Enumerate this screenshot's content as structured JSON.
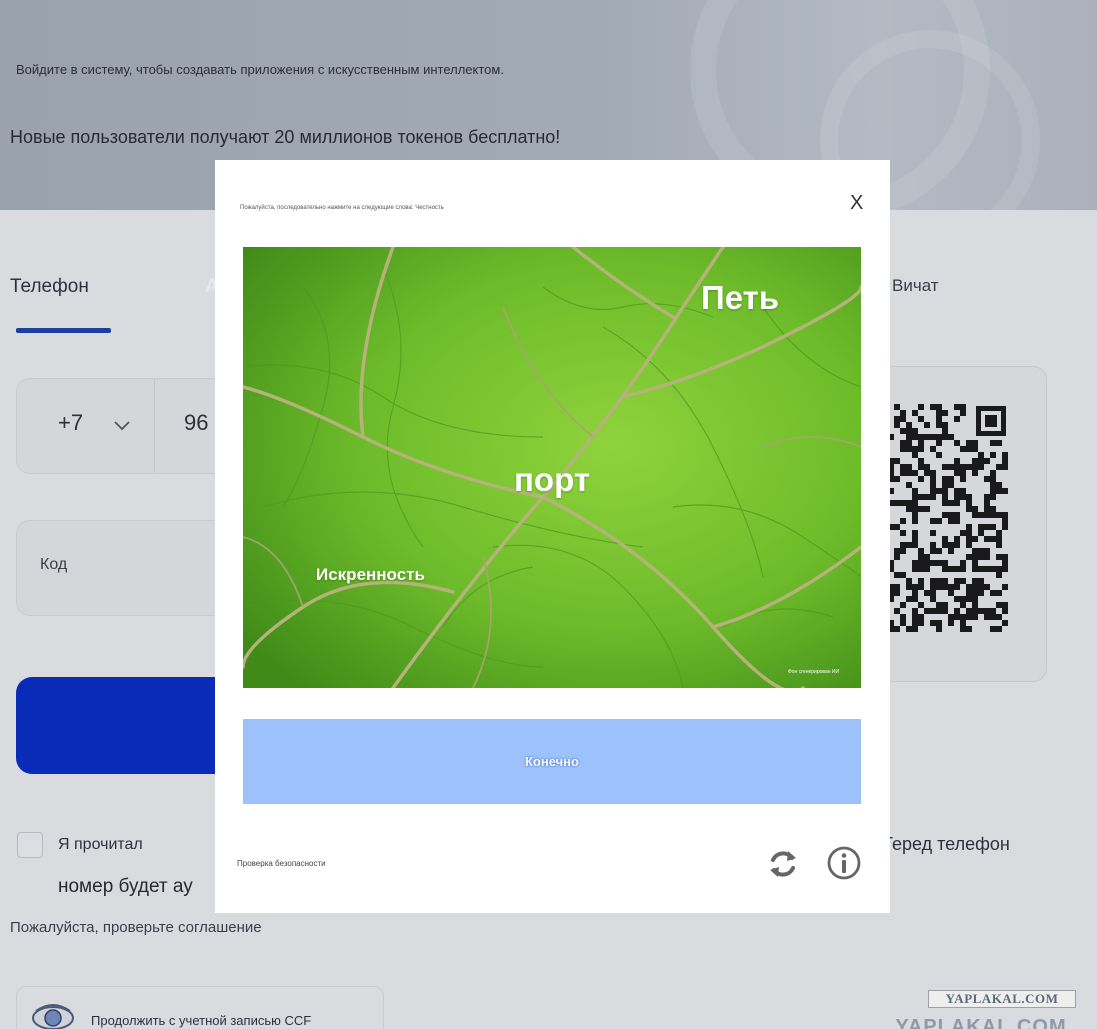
{
  "hero": {
    "subtitle": "Войдите в систему, чтобы создавать приложения с искусственным интеллектом.",
    "promo": "Новые пользователи получают 20 миллионов токенов бесплатно!"
  },
  "tabs": {
    "phone": "Телефон",
    "second": "А",
    "wechat": "Вичат"
  },
  "form": {
    "country_code": "+7",
    "phone_value": "96",
    "code_label": "Код"
  },
  "agreement": {
    "checkbox_text": "Я прочитал",
    "line2": "номер будет ау",
    "right_text": "Теред телефон",
    "warning": "Пожалуйста, проверьте соглашение"
  },
  "ccf": {
    "label": "Продолжить с учетной записью CCF"
  },
  "watermark": {
    "top": "YAPLAKAL.COM",
    "bottom": "YAPLAKAL.COM"
  },
  "captcha": {
    "hint": "Пожалуйста, последовательно нажмите на следующие слова: Честность",
    "close": "X",
    "words": [
      "Петь",
      "порт",
      "Искренность"
    ],
    "image_credit": "Фон сгенерирован ИИ",
    "confirm_label": "Конечно",
    "security_label": "Проверка безопасности"
  },
  "icons": {
    "refresh": "refresh-icon",
    "info": "info-icon",
    "chevron": "chevron-down-icon",
    "ccf": "ccf-logo-icon"
  },
  "colors": {
    "primary_button": "#0a2bb8",
    "confirm_button": "#9cc1fb",
    "tab_underline": "#1f3f9e"
  }
}
